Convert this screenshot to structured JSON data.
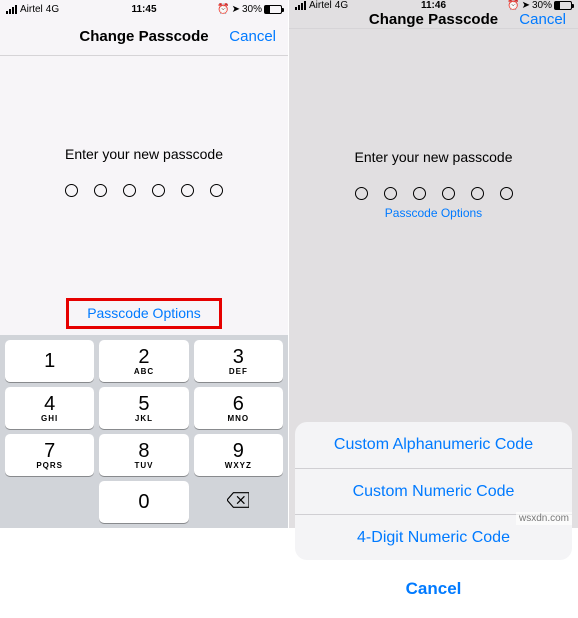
{
  "left": {
    "status": {
      "carrier": "Airtel",
      "network": "4G",
      "time": "11:45",
      "battery": "30%"
    },
    "nav": {
      "title": "Change Passcode",
      "cancel": "Cancel"
    },
    "prompt": "Enter your new passcode",
    "options_label": "Passcode Options",
    "keypad": [
      {
        "n": "1",
        "l": ""
      },
      {
        "n": "2",
        "l": "ABC"
      },
      {
        "n": "3",
        "l": "DEF"
      },
      {
        "n": "4",
        "l": "GHI"
      },
      {
        "n": "5",
        "l": "JKL"
      },
      {
        "n": "6",
        "l": "MNO"
      },
      {
        "n": "7",
        "l": "PQRS"
      },
      {
        "n": "8",
        "l": "TUV"
      },
      {
        "n": "9",
        "l": "WXYZ"
      },
      {
        "n": "0",
        "l": ""
      }
    ]
  },
  "right": {
    "status": {
      "carrier": "Airtel",
      "network": "4G",
      "time": "11:46",
      "battery": "30%"
    },
    "nav": {
      "title": "Change Passcode",
      "cancel": "Cancel"
    },
    "prompt": "Enter your new passcode",
    "options_label": "Passcode Options",
    "sheet": {
      "items": [
        "Custom Alphanumeric Code",
        "Custom Numeric Code",
        "4-Digit Numeric Code"
      ],
      "cancel": "Cancel"
    }
  },
  "watermark": "wsxdn.com"
}
